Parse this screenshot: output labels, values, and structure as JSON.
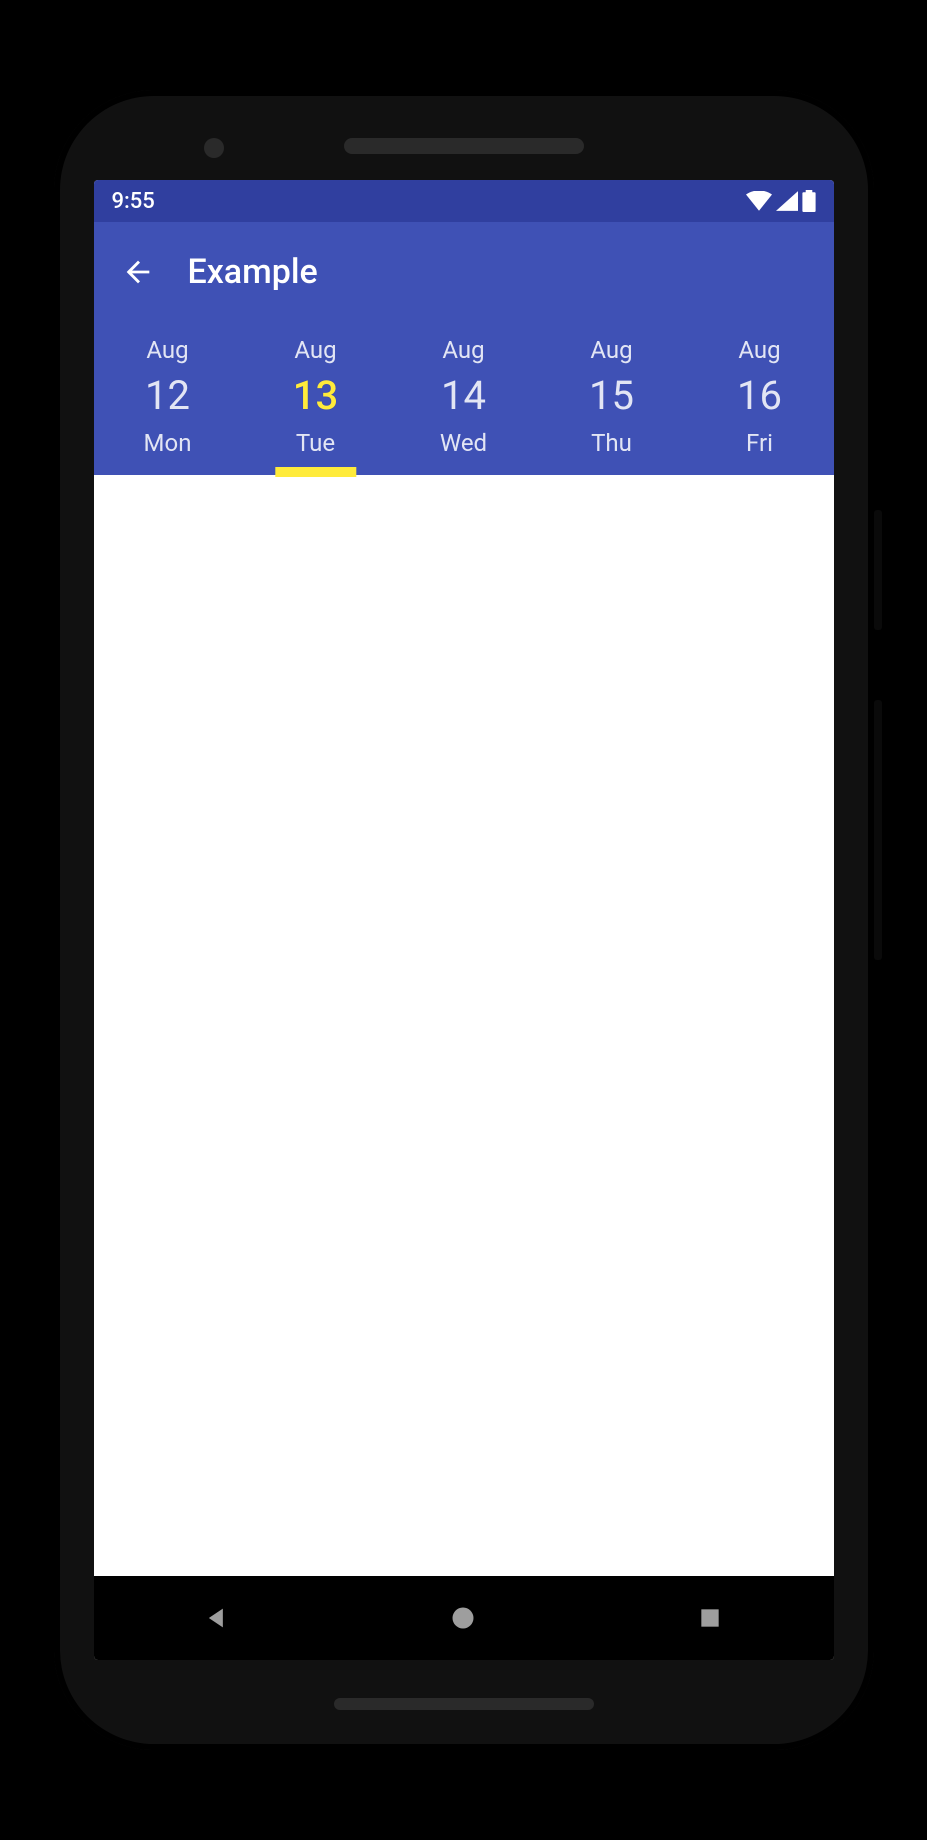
{
  "statusbar": {
    "time": "9:55"
  },
  "appbar": {
    "title": "Example"
  },
  "dates": [
    {
      "month": "Aug",
      "day": "12",
      "dow": "Mon",
      "selected": false
    },
    {
      "month": "Aug",
      "day": "13",
      "dow": "Tue",
      "selected": true
    },
    {
      "month": "Aug",
      "day": "14",
      "dow": "Wed",
      "selected": false
    },
    {
      "month": "Aug",
      "day": "15",
      "dow": "Thu",
      "selected": false
    },
    {
      "month": "Aug",
      "day": "16",
      "dow": "Fri",
      "selected": false
    }
  ],
  "colors": {
    "primary": "#3F51B5",
    "primaryDark": "#303F9F",
    "accent": "#FFEB3B"
  }
}
